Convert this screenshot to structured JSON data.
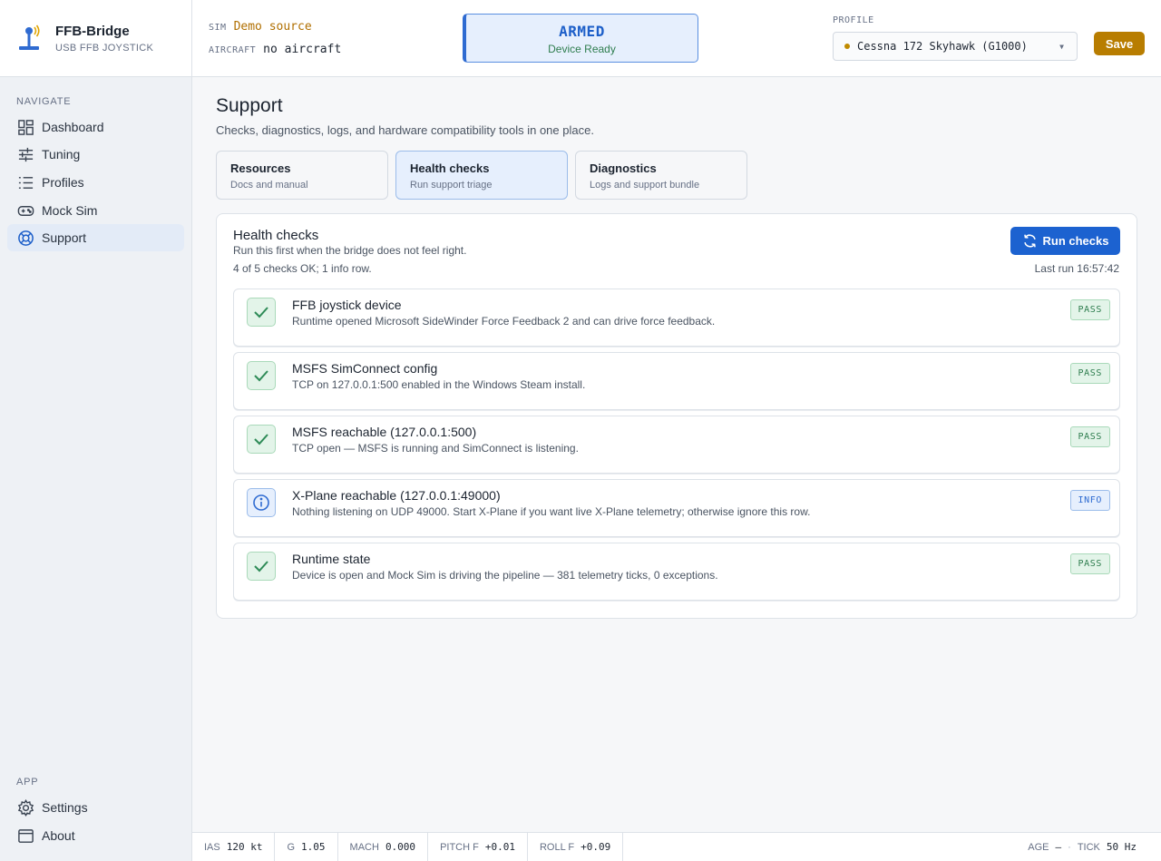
{
  "brand": {
    "title": "FFB-Bridge",
    "subtitle": "USB FFB JOYSTICK"
  },
  "sidebar": {
    "navigate_heading": "NAVIGATE",
    "items": [
      {
        "label": "Dashboard",
        "icon": "dashboard-icon"
      },
      {
        "label": "Tuning",
        "icon": "sliders-icon"
      },
      {
        "label": "Profiles",
        "icon": "list-icon"
      },
      {
        "label": "Mock Sim",
        "icon": "gamepad-icon"
      },
      {
        "label": "Support",
        "icon": "lifebuoy-icon",
        "active": true
      }
    ],
    "app_heading": "APP",
    "app_items": [
      {
        "label": "Settings",
        "icon": "gear-icon"
      },
      {
        "label": "About",
        "icon": "window-icon"
      }
    ]
  },
  "header": {
    "sim_key": "SIM",
    "sim_value": "Demo source",
    "aircraft_key": "AIRCRAFT",
    "aircraft_value": "no aircraft",
    "armed_title": "ARMED",
    "armed_sub": "Device Ready",
    "profile_label": "PROFILE",
    "profile_value": "Cessna 172 Skyhawk (G1000)",
    "save_label": "Save"
  },
  "page": {
    "title": "Support",
    "subtitle": "Checks, diagnostics, logs, and hardware compatibility tools in one place.",
    "tabs": [
      {
        "title": "Resources",
        "sub": "Docs and manual"
      },
      {
        "title": "Health checks",
        "sub": "Run support triage",
        "active": true
      },
      {
        "title": "Diagnostics",
        "sub": "Logs and support bundle"
      }
    ]
  },
  "health": {
    "title": "Health checks",
    "subtitle": "Run this first when the bridge does not feel right.",
    "summary": "4 of 5 checks OK; 1 info row.",
    "run_label": "Run checks",
    "last_run": "Last run 16:57:42",
    "checks": [
      {
        "title": "FFB joystick device",
        "desc": "Runtime opened Microsoft SideWinder Force Feedback 2 and can drive force feedback.",
        "status": "PASS"
      },
      {
        "title": "MSFS SimConnect config",
        "desc": "TCP on 127.0.0.1:500 enabled in the Windows Steam install.",
        "status": "PASS"
      },
      {
        "title": "MSFS reachable (127.0.0.1:500)",
        "desc": "TCP open — MSFS is running and SimConnect is listening.",
        "status": "PASS"
      },
      {
        "title": "X-Plane reachable (127.0.0.1:49000)",
        "desc": "Nothing listening on UDP 49000. Start X-Plane if you want live X-Plane telemetry; otherwise ignore this row.",
        "status": "INFO"
      },
      {
        "title": "Runtime state",
        "desc": "Device is open and Mock Sim is driving the pipeline — 381 telemetry ticks, 0 exceptions.",
        "status": "PASS"
      }
    ]
  },
  "statusbar": {
    "ias_k": "IAS",
    "ias_v": "120 kt",
    "g_k": "G",
    "g_v": "1.05",
    "mach_k": "MACH",
    "mach_v": "0.000",
    "pitch_k": "PITCH F",
    "pitch_v": "+0.01",
    "roll_k": "ROLL F",
    "roll_v": "+0.09",
    "age_k": "AGE",
    "age_v": "—",
    "sep": "·",
    "tick_k": "TICK",
    "tick_v": "50 Hz"
  },
  "colors": {
    "accent": "#1c62d0",
    "save": "#b87d00",
    "pass": "#2e7d4e",
    "info": "#2f6bd1",
    "sim_value": "#b06f00"
  }
}
